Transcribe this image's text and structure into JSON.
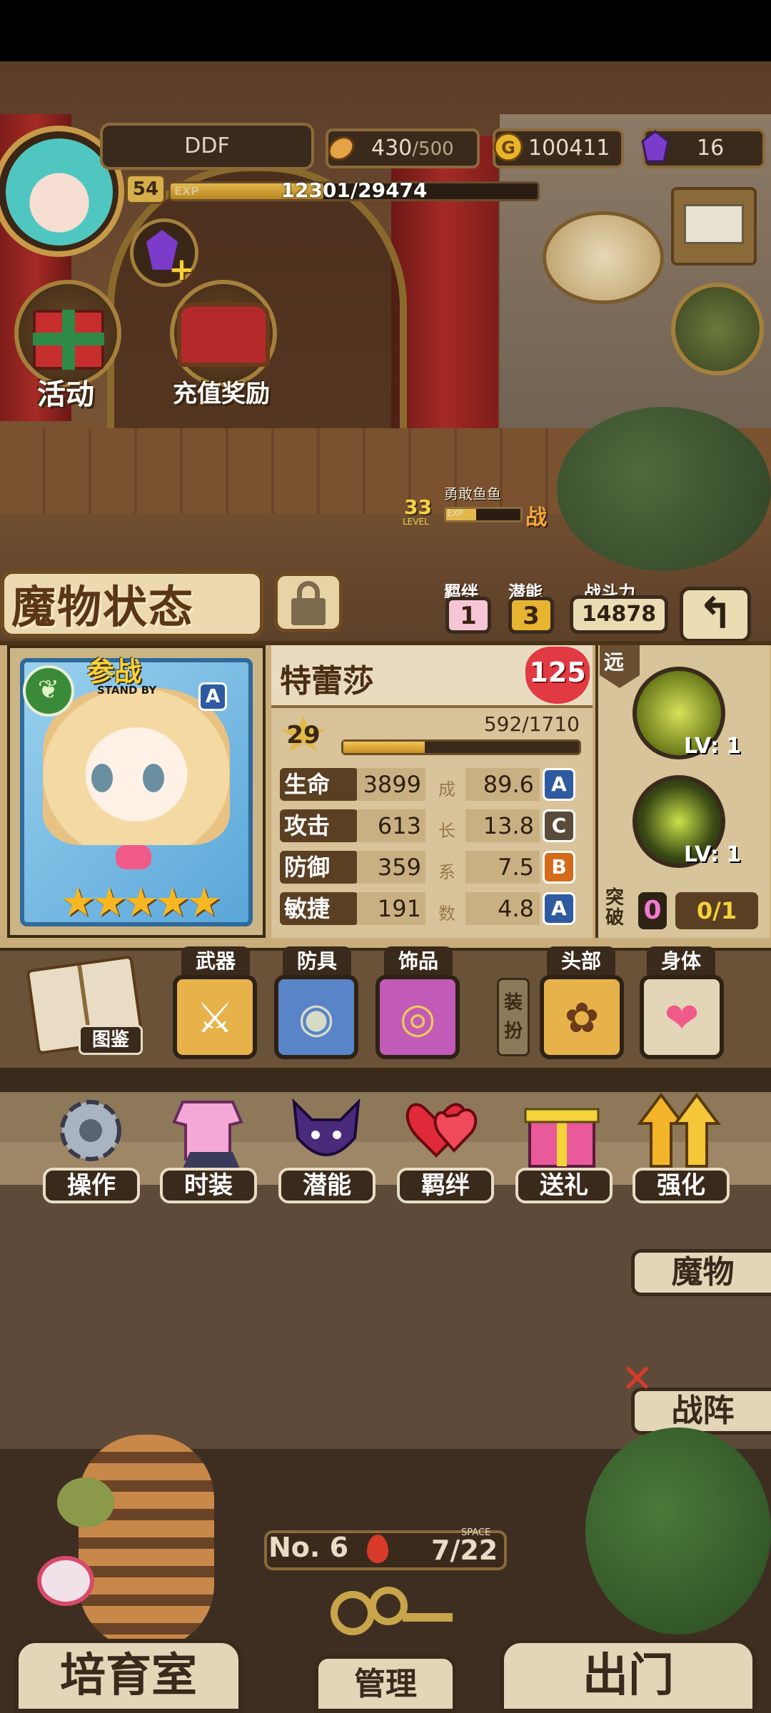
{
  "player": {
    "name": "DDF",
    "level": "54",
    "exp_tag": "EXP",
    "exp_text": "12301/29474",
    "exp_ratio": 0.417
  },
  "resources": {
    "stamina": "430",
    "stamina_max": "/500",
    "gold": "100411",
    "gems": "16"
  },
  "hud": {
    "activity_label": "活动",
    "recharge_label": "充值奖励"
  },
  "enemy": {
    "name": "勇敢鱼鱼",
    "level": "33",
    "level_tag": "LEVEL",
    "exp_tag": "EXP",
    "battle": "战"
  },
  "header": {
    "title": "魔物状态",
    "bond_label": "羁绊",
    "bond_value": "1",
    "potential_label": "潜能",
    "potential_value": "3",
    "power_label": "战斗力",
    "power_value": "14878",
    "back_icon": "return-arrow-icon"
  },
  "card": {
    "standby_cn": "参战",
    "standby_en": "STAND BY",
    "rank": "A",
    "stars": "★★★★★",
    "element_icon": "leaf-icon"
  },
  "monster": {
    "name": "特蕾莎",
    "heart_level": "125",
    "level": "29",
    "exp_text": "592/1710",
    "exp_ratio": 0.346
  },
  "stats": [
    {
      "label": "生命",
      "value": "3899",
      "growth_char": "成",
      "growth": "89.6",
      "grade": "A",
      "grade_color": "#2e5aa0"
    },
    {
      "label": "攻击",
      "value": "613",
      "growth_char": "长",
      "growth": "13.8",
      "grade": "C",
      "grade_color": "#5a4a3a"
    },
    {
      "label": "防御",
      "value": "359",
      "growth_char": "系",
      "growth": "7.5",
      "grade": "B",
      "grade_color": "#d46a1a"
    },
    {
      "label": "敏捷",
      "value": "191",
      "growth_char": "数",
      "growth": "4.8",
      "grade": "A",
      "grade_color": "#2e5aa0"
    }
  ],
  "side": {
    "range_label": "远",
    "skill1_lv": "LV: 1",
    "skill2_lv": "LV: 1",
    "break_label": "突破",
    "break_value": "0",
    "break_progress": "0/1"
  },
  "equipment": {
    "guide_label": "图鉴",
    "weapon": "武器",
    "armor": "防具",
    "accessory": "饰品",
    "dress_up": "装扮",
    "head": "头部",
    "body": "身体"
  },
  "actions": [
    {
      "label": "操作",
      "icon": "gear-icon"
    },
    {
      "label": "时装",
      "icon": "clothes-icon"
    },
    {
      "label": "潜能",
      "icon": "demon-icon"
    },
    {
      "label": "羁绊",
      "icon": "hearts-icon"
    },
    {
      "label": "送礼",
      "icon": "gift-icon"
    },
    {
      "label": "强化",
      "icon": "upgrade-arrows-icon"
    }
  ],
  "side_nav": {
    "monsters": "魔物",
    "formation": "战阵"
  },
  "capacity": {
    "no": "No. 6",
    "space_tag": "SPACE",
    "value": "7/22"
  },
  "bottom": {
    "nursery": "培育室",
    "manage": "管理",
    "exit": "出门"
  }
}
